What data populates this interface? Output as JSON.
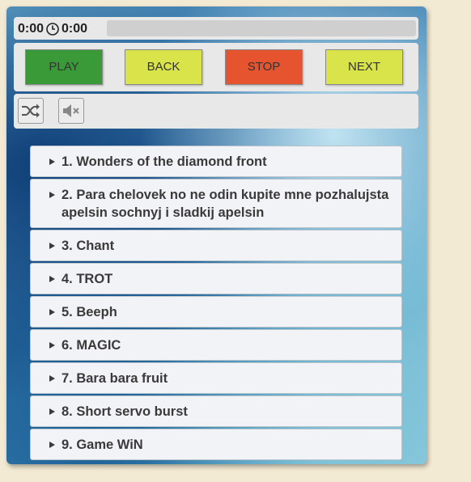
{
  "player": {
    "time_current": "0:00",
    "time_total": "0:00",
    "progress_fraction": 0
  },
  "controls": {
    "play_label": "PLAY",
    "back_label": "BACK",
    "stop_label": "STOP",
    "next_label": "NEXT"
  },
  "toolbar": {
    "shuffle_icon": "shuffle-icon",
    "mute_icon": "speaker-muted-icon"
  },
  "playlist": {
    "items": [
      {
        "label": "1. Wonders of the diamond front"
      },
      {
        "label": "2. Para chelovek no ne odin kupite mne pozhalujsta apelsin sochnyj i sladkij apelsin"
      },
      {
        "label": "3. Chant"
      },
      {
        "label": "4. TROT"
      },
      {
        "label": "5. Beeph"
      },
      {
        "label": "6. MAGIC"
      },
      {
        "label": "7. Bara bara fruit"
      },
      {
        "label": "8. Short servo burst"
      },
      {
        "label": "9. Game WiN"
      }
    ]
  },
  "colors": {
    "play": "#3a9a37",
    "back": "#d9e44a",
    "stop": "#e5542f",
    "next": "#d9e44a"
  }
}
